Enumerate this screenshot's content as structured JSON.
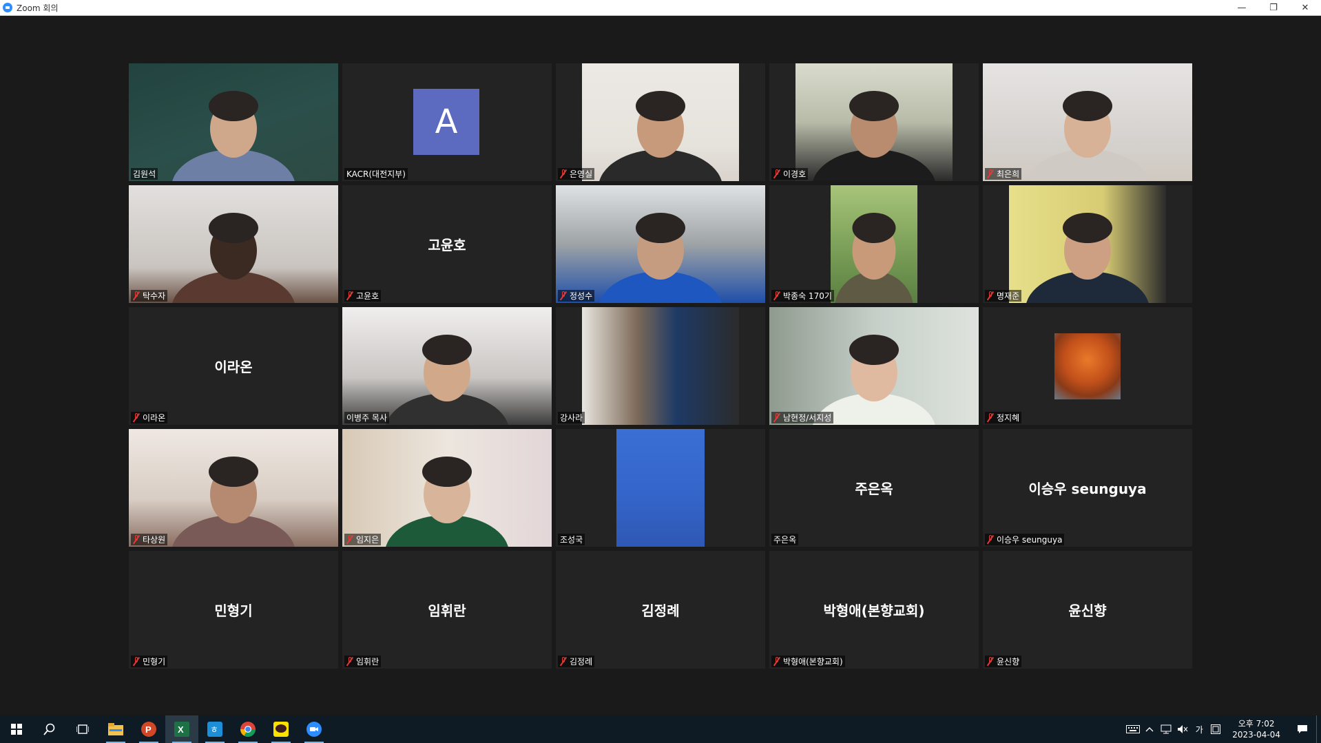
{
  "window": {
    "title": "Zoom 회의",
    "minimize": "—",
    "restore": "❐",
    "close": "✕"
  },
  "participants": [
    {
      "name": "김원석",
      "type": "video",
      "active": true,
      "muted": false
    },
    {
      "name": "KACR(대전지부)",
      "type": "avatar",
      "avatar_letter": "A",
      "muted": false
    },
    {
      "name": "은영실",
      "type": "video",
      "muted": true
    },
    {
      "name": "이경호",
      "type": "video",
      "muted": true
    },
    {
      "name": "최은희",
      "type": "video",
      "muted": true
    },
    {
      "name": "탁수자",
      "type": "video",
      "muted": true
    },
    {
      "name": "고윤호",
      "type": "name",
      "display": "고윤호",
      "muted": true
    },
    {
      "name": "정성수",
      "type": "video",
      "muted": true
    },
    {
      "name": "박종숙 170기",
      "type": "video",
      "muted": true
    },
    {
      "name": "명재준",
      "type": "video",
      "muted": true
    },
    {
      "name": "이라온",
      "type": "name",
      "display": "이라온",
      "muted": true
    },
    {
      "name": "이병주 목사",
      "type": "video",
      "muted": false
    },
    {
      "name": "강사라",
      "type": "video",
      "muted": false
    },
    {
      "name": "남현정/서지성",
      "type": "video",
      "muted": true
    },
    {
      "name": "정지혜",
      "type": "image",
      "muted": true
    },
    {
      "name": "타상원",
      "type": "video",
      "muted": true
    },
    {
      "name": "임지은",
      "type": "video",
      "muted": true
    },
    {
      "name": "조성국",
      "type": "video",
      "muted": false
    },
    {
      "name": "주은옥",
      "type": "name",
      "display": "주은옥",
      "muted": false
    },
    {
      "name": "이승우 seunguya",
      "type": "name",
      "display": "이승우 seunguya",
      "muted": true
    },
    {
      "name": "민형기",
      "type": "name",
      "display": "민형기",
      "muted": true
    },
    {
      "name": "임휘란",
      "type": "name",
      "display": "임휘란",
      "muted": true
    },
    {
      "name": "김정례",
      "type": "name",
      "display": "김정례",
      "muted": true
    },
    {
      "name": "박형애(본향교회)",
      "type": "name",
      "display": "박형애(본향교회)",
      "muted": true
    },
    {
      "name": "윤신향",
      "type": "name",
      "display": "윤신향",
      "muted": true
    }
  ],
  "taskbar": {
    "items": [
      "windows-start",
      "search",
      "task-view",
      "file-explorer",
      "powerpoint",
      "excel",
      "hancom",
      "chrome",
      "kakaotalk",
      "zoom"
    ],
    "clock_time": "오후 7:02",
    "clock_date": "2023-04-04",
    "ime": "가"
  },
  "colors": {
    "active_speaker": "#d7e64a",
    "avatar_bg": "#5c6bc0",
    "muted_icon": "#e53935",
    "tile_bg": "#232323"
  }
}
